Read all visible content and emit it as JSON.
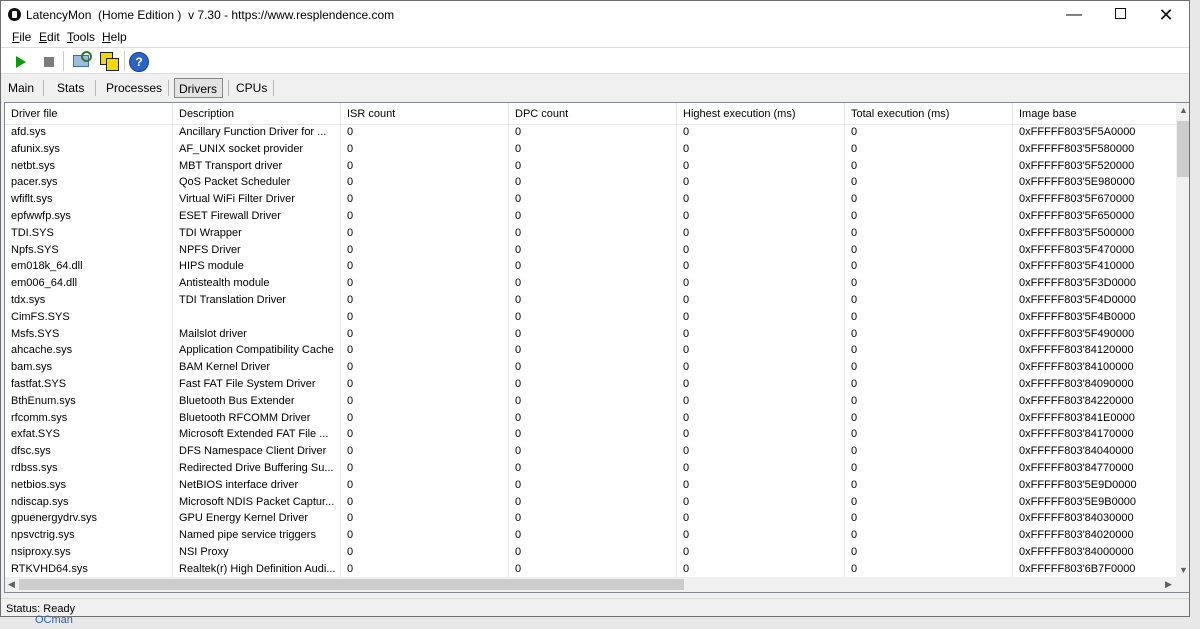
{
  "window": {
    "title": "LatencyMon  (Home Edition )  v 7.30 - https://www.resplendence.com",
    "minimize": "—",
    "close": "✕"
  },
  "menu": {
    "file": "File",
    "edit": "Edit",
    "tools": "Tools",
    "help": "Help"
  },
  "toolbar": {
    "start_icon": "play-icon",
    "stop_icon": "stop-icon",
    "find_icon": "find-process-icon",
    "windows_icon": "windows-icon",
    "help_icon": "help-icon",
    "help_glyph": "?"
  },
  "tabs": [
    "Main",
    "Stats",
    "Processes",
    "Drivers",
    "CPUs"
  ],
  "selected_tab": "Drivers",
  "table": {
    "columns": [
      "Driver file",
      "Description",
      "ISR count",
      "DPC count",
      "Highest execution (ms)",
      "Total execution (ms)",
      "Image base"
    ],
    "rows": [
      [
        "afd.sys",
        "Ancillary Function Driver for ...",
        "0",
        "0",
        "0",
        "0",
        "0xFFFFF803'5F5A0000"
      ],
      [
        "afunix.sys",
        "AF_UNIX socket provider",
        "0",
        "0",
        "0",
        "0",
        "0xFFFFF803'5F580000"
      ],
      [
        "netbt.sys",
        "MBT Transport driver",
        "0",
        "0",
        "0",
        "0",
        "0xFFFFF803'5F520000"
      ],
      [
        "pacer.sys",
        "QoS Packet Scheduler",
        "0",
        "0",
        "0",
        "0",
        "0xFFFFF803'5E980000"
      ],
      [
        "wfiflt.sys",
        "Virtual WiFi Filter Driver",
        "0",
        "0",
        "0",
        "0",
        "0xFFFFF803'5F670000"
      ],
      [
        "epfwwfp.sys",
        "ESET Firewall Driver",
        "0",
        "0",
        "0",
        "0",
        "0xFFFFF803'5F650000"
      ],
      [
        "TDI.SYS",
        "TDI Wrapper",
        "0",
        "0",
        "0",
        "0",
        "0xFFFFF803'5F500000"
      ],
      [
        "Npfs.SYS",
        "NPFS Driver",
        "0",
        "0",
        "0",
        "0",
        "0xFFFFF803'5F470000"
      ],
      [
        "em018k_64.dll",
        "HIPS module",
        "0",
        "0",
        "0",
        "0",
        "0xFFFFF803'5F410000"
      ],
      [
        "em006_64.dll",
        "Antistealth module",
        "0",
        "0",
        "0",
        "0",
        "0xFFFFF803'5F3D0000"
      ],
      [
        "tdx.sys",
        "TDI Translation Driver",
        "0",
        "0",
        "0",
        "0",
        "0xFFFFF803'5F4D0000"
      ],
      [
        "CimFS.SYS",
        "",
        "0",
        "0",
        "0",
        "0",
        "0xFFFFF803'5F4B0000"
      ],
      [
        "Msfs.SYS",
        "Mailslot driver",
        "0",
        "0",
        "0",
        "0",
        "0xFFFFF803'5F490000"
      ],
      [
        "ahcache.sys",
        "Application Compatibility Cache",
        "0",
        "0",
        "0",
        "0",
        "0xFFFFF803'84120000"
      ],
      [
        "bam.sys",
        "BAM Kernel Driver",
        "0",
        "0",
        "0",
        "0",
        "0xFFFFF803'84100000"
      ],
      [
        "fastfat.SYS",
        "Fast FAT File System Driver",
        "0",
        "0",
        "0",
        "0",
        "0xFFFFF803'84090000"
      ],
      [
        "BthEnum.sys",
        "Bluetooth Bus Extender",
        "0",
        "0",
        "0",
        "0",
        "0xFFFFF803'84220000"
      ],
      [
        "rfcomm.sys",
        "Bluetooth RFCOMM Driver",
        "0",
        "0",
        "0",
        "0",
        "0xFFFFF803'841E0000"
      ],
      [
        "exfat.SYS",
        "Microsoft Extended FAT File ...",
        "0",
        "0",
        "0",
        "0",
        "0xFFFFF803'84170000"
      ],
      [
        "dfsc.sys",
        "DFS Namespace Client Driver",
        "0",
        "0",
        "0",
        "0",
        "0xFFFFF803'84040000"
      ],
      [
        "rdbss.sys",
        "Redirected Drive Buffering Su...",
        "0",
        "0",
        "0",
        "0",
        "0xFFFFF803'84770000"
      ],
      [
        "netbios.sys",
        "NetBIOS interface driver",
        "0",
        "0",
        "0",
        "0",
        "0xFFFFF803'5E9D0000"
      ],
      [
        "ndiscap.sys",
        "Microsoft NDIS Packet Captur...",
        "0",
        "0",
        "0",
        "0",
        "0xFFFFF803'5E9B0000"
      ],
      [
        "gpuenergydrv.sys",
        "GPU Energy Kernel Driver",
        "0",
        "0",
        "0",
        "0",
        "0xFFFFF803'84030000"
      ],
      [
        "npsvctrig.sys",
        "Named pipe service triggers",
        "0",
        "0",
        "0",
        "0",
        "0xFFFFF803'84020000"
      ],
      [
        "nsiproxy.sys",
        "NSI Proxy",
        "0",
        "0",
        "0",
        "0",
        "0xFFFFF803'84000000"
      ],
      [
        "RTKVHD64.sys",
        "Realtek(r) High Definition Audi...",
        "0",
        "0",
        "0",
        "0",
        "0xFFFFF803'6B7F0000"
      ]
    ]
  },
  "status": "Status: Ready",
  "background_text": "OCman"
}
